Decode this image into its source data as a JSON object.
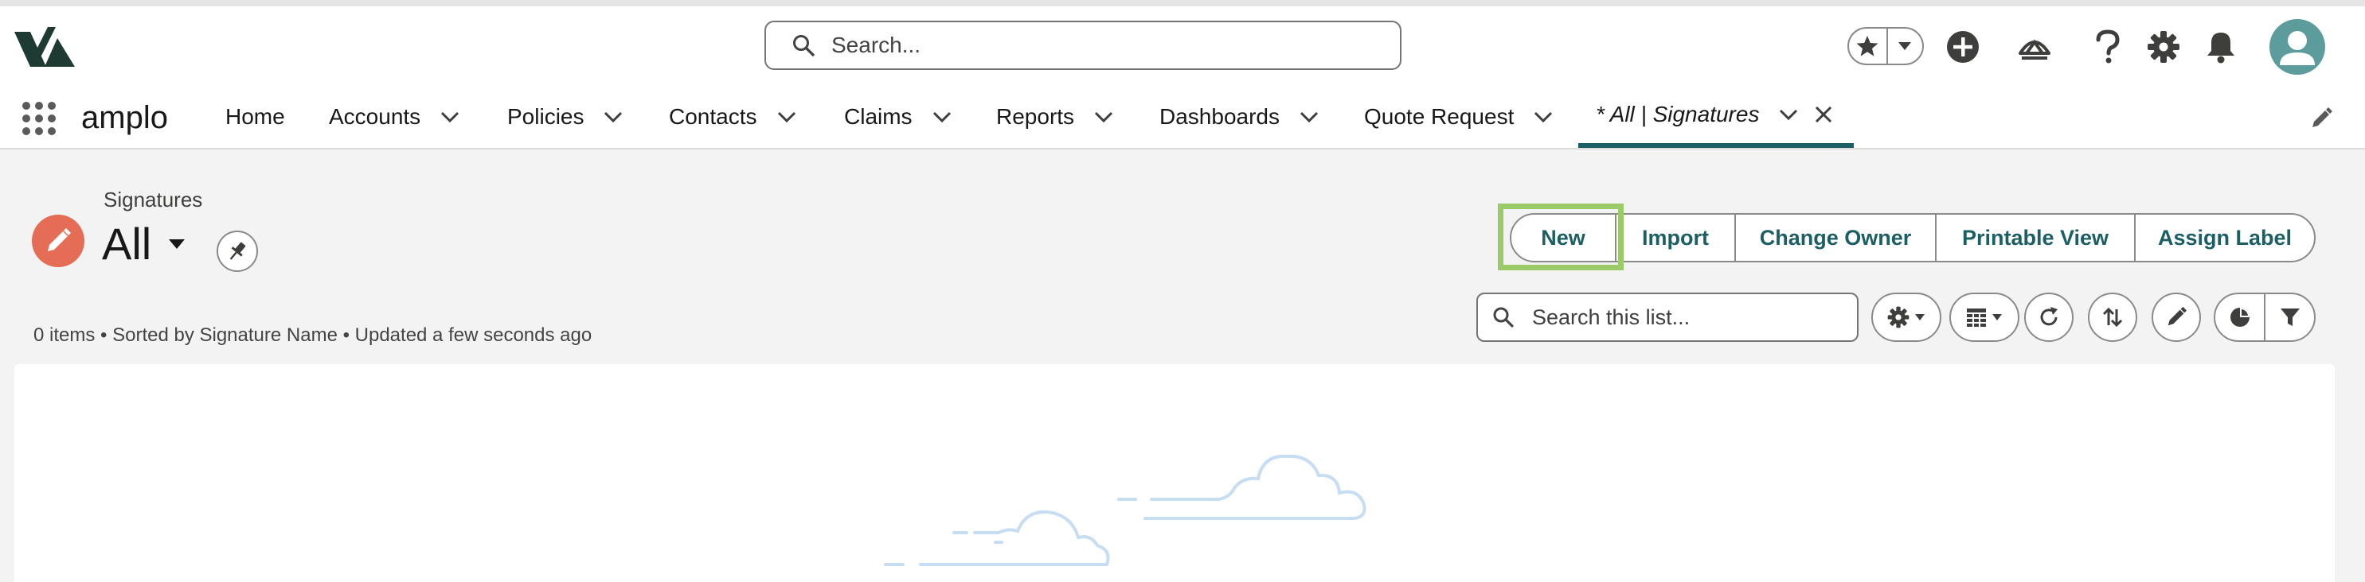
{
  "global_header": {
    "search_placeholder": "Search...",
    "icons": [
      "logo-icon",
      "search-icon",
      "star-icon",
      "chevron-down-icon",
      "add-icon",
      "trailhead-icon",
      "help-icon",
      "setup-gear-icon",
      "notification-bell-icon",
      "avatar-icon"
    ]
  },
  "nav": {
    "app_name": "amplo",
    "items": [
      {
        "label": "Home",
        "has_menu": false
      },
      {
        "label": "Accounts",
        "has_menu": true
      },
      {
        "label": "Policies",
        "has_menu": true
      },
      {
        "label": "Contacts",
        "has_menu": true
      },
      {
        "label": "Claims",
        "has_menu": true
      },
      {
        "label": "Reports",
        "has_menu": true
      },
      {
        "label": "Dashboards",
        "has_menu": true
      },
      {
        "label": "Quote Request",
        "has_menu": true
      }
    ],
    "active_tab": {
      "label": "* All | Signatures"
    }
  },
  "list_header": {
    "object_label": "Signatures",
    "list_view_name": "All",
    "meta": "0 items • Sorted by Signature Name • Updated a few seconds ago",
    "actions": [
      "New",
      "Import",
      "Change Owner",
      "Printable View",
      "Assign Label"
    ],
    "search_placeholder": "Search this list...",
    "highlight_color": "#9acb68"
  },
  "colors": {
    "brand": "#1b5f65",
    "object_icon": "#e56d55",
    "avatar": "#5d9c9c",
    "illustration": "#c6ddf2"
  }
}
